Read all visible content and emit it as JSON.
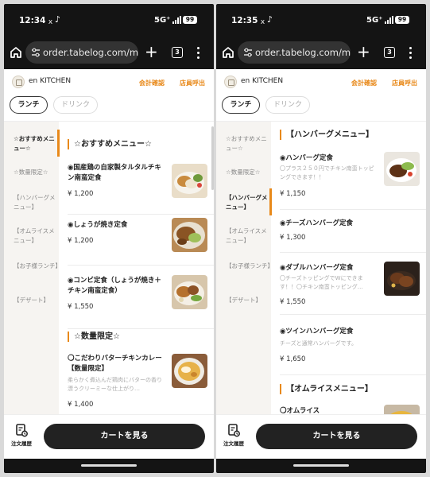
{
  "colors": {
    "accent": "#e8891a",
    "dark": "#141414",
    "cart": "#222222"
  },
  "left": {
    "status": {
      "time": "12:34",
      "net": "5G⁺",
      "battery": "99"
    },
    "browser": {
      "url": "order.tabelog.com/menu"
    },
    "header": {
      "shop": "en KITCHEN",
      "check": "会計確認",
      "call": "店員呼出"
    },
    "tabs": [
      "ランチ",
      "ドリンク"
    ],
    "sidebar": [
      "☆おすすめメニュー☆",
      "☆数量限定☆",
      "【ハンバーグメニュー】",
      "【オムライスメニュー】",
      "【お子様ランチ】",
      "【デザート】"
    ],
    "sections": [
      {
        "title": "☆おすすめメニュー☆"
      },
      {
        "title": "☆数量限定☆"
      }
    ],
    "items": [
      {
        "name": "◉国産鶏の自家製タルタルチキン南蛮定食",
        "desc": "",
        "price": "¥ 1,200"
      },
      {
        "name": "◉しょうが焼き定食",
        "desc": "",
        "price": "¥ 1,200"
      },
      {
        "name": "◉コンビ定食（しょうが焼き＋チキン南蛮定食）",
        "desc": "",
        "price": "¥ 1,550"
      },
      {
        "name": "〇こだわりバターチキンカレー【数量限定】",
        "desc": "柔らかく煮込んだ鶏肉にバターの香り漂うクリーミーな仕上がり…",
        "price": "¥ 1,400"
      }
    ],
    "bottom": {
      "history": "注文履歴",
      "cart": "カートを見る"
    }
  },
  "right": {
    "status": {
      "time": "12:35",
      "net": "5G⁺",
      "battery": "99"
    },
    "browser": {
      "url": "order.tabelog.com/menu"
    },
    "header": {
      "shop": "en KITCHEN",
      "check": "会計確認",
      "call": "店員呼出"
    },
    "tabs": [
      "ランチ",
      "ドリンク"
    ],
    "sidebar": [
      "☆おすすめメニュー☆",
      "☆数量限定☆",
      "【ハンバーグメニュー】",
      "【オムライスメニュー】",
      "【お子様ランチ】",
      "【デザート】"
    ],
    "sections": [
      {
        "title": "【ハンバーグメニュー】"
      },
      {
        "title": "【オムライスメニュー】"
      }
    ],
    "items": [
      {
        "name": "◉ハンバーグ定食",
        "desc": "〇プラス２５０円でチキン南蛮トッピングできます！！",
        "price": "¥ 1,150"
      },
      {
        "name": "◉チーズハンバーグ定食",
        "desc": "",
        "price": "¥ 1,300"
      },
      {
        "name": "◉ダブルハンバーグ定食",
        "desc": "〇チーズトッピングでWにできます！！〇チキン南蛮トッピング…",
        "price": "¥ 1,550"
      },
      {
        "name": "◉ツインハンバーグ定食",
        "desc": "チーズと通常ハンバーグです。",
        "price": "¥ 1,650"
      },
      {
        "name": "〇オムライス",
        "desc": "",
        "price": ""
      }
    ],
    "bottom": {
      "history": "注文履歴",
      "cart": "カートを見る"
    }
  }
}
